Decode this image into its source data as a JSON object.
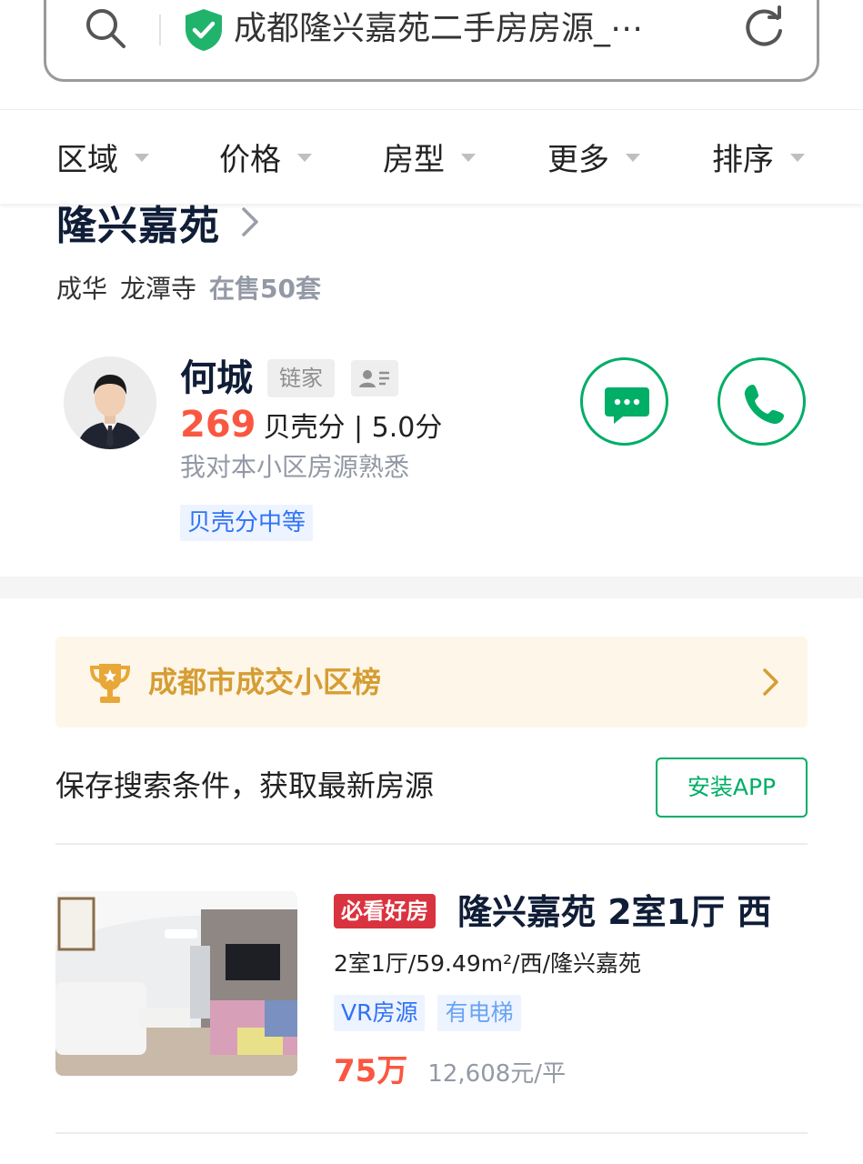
{
  "browser": {
    "url_text": "成都隆兴嘉苑二手房房源_⋯",
    "search_icon": "search-icon",
    "secure_icon": "shield-check-icon",
    "reload_icon": "reload-icon"
  },
  "filters": [
    {
      "label": "区域",
      "icon": "caret-down-icon"
    },
    {
      "label": "价格",
      "icon": "caret-down-icon"
    },
    {
      "label": "房型",
      "icon": "caret-down-icon"
    },
    {
      "label": "更多",
      "icon": "caret-down-icon"
    },
    {
      "label": "排序",
      "icon": "caret-down-icon"
    }
  ],
  "community": {
    "name": "隆兴嘉苑",
    "district": "成华",
    "area": "龙潭寺",
    "on_sale": "在售50套"
  },
  "agent": {
    "name": "何城",
    "brand": "链家",
    "score": "269",
    "score_text": "贝壳分 | 5.0分",
    "description": "我对本小区房源熟悉",
    "tag": "贝壳分中等",
    "chat_icon": "chat-bubble-icon",
    "phone_icon": "phone-icon"
  },
  "ranking": {
    "label": "成都市成交小区榜",
    "icon": "trophy-icon"
  },
  "save_search": {
    "text": "保存搜索条件，获取最新房源",
    "button": "安装APP"
  },
  "listings": [
    {
      "badge": "必看好房",
      "title": "隆兴嘉苑 2室1厅 西",
      "info": "2室1厅/59.49m²/西/隆兴嘉苑",
      "tags": [
        "VR房源",
        "有电梯"
      ],
      "price": "75万",
      "unit_price": "12,608元/平"
    }
  ],
  "colors": {
    "brand_green": "#00ae66",
    "price_red": "#fa5741",
    "badge_red": "#d9333f",
    "tag_blue": "#3072f6",
    "rank_gold": "#d59d33"
  }
}
